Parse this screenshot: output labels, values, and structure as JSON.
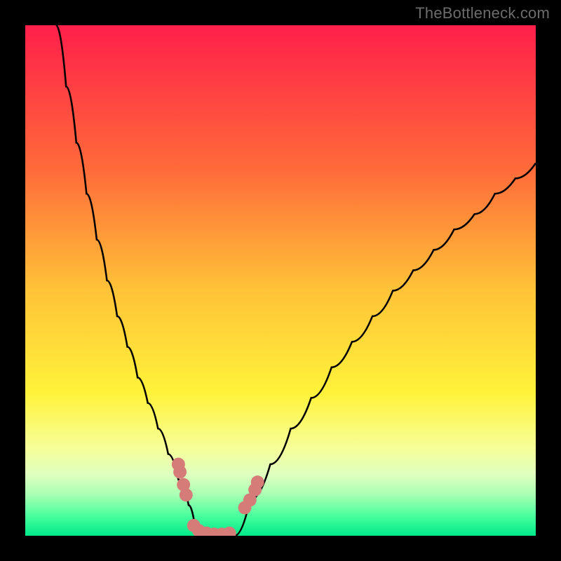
{
  "watermark": "TheBottleneck.com",
  "colors": {
    "frame": "#000000",
    "curve_stroke": "#000000",
    "marker_fill": "#d67c78",
    "gradient_stops": [
      {
        "offset": 0.0,
        "color": "#ff1f4a"
      },
      {
        "offset": 0.28,
        "color": "#ff6a3a"
      },
      {
        "offset": 0.52,
        "color": "#ffc338"
      },
      {
        "offset": 0.72,
        "color": "#fff23a"
      },
      {
        "offset": 0.83,
        "color": "#f6ff9a"
      },
      {
        "offset": 0.88,
        "color": "#dfffc0"
      },
      {
        "offset": 0.92,
        "color": "#a8ffb3"
      },
      {
        "offset": 0.96,
        "color": "#4bff9e"
      },
      {
        "offset": 1.0,
        "color": "#00e98a"
      }
    ]
  },
  "chart_data": {
    "type": "line",
    "title": "",
    "xlabel": "",
    "ylabel": "",
    "xlim": [
      0,
      100
    ],
    "ylim": [
      0,
      100
    ],
    "series": [
      {
        "name": "left-curve",
        "x": [
          6,
          8,
          10,
          12,
          14,
          16,
          18,
          20,
          22,
          24,
          26,
          28,
          30,
          32,
          33.5
        ],
        "y": [
          100,
          88,
          77,
          67,
          58,
          50,
          43,
          37,
          31,
          26,
          21,
          16,
          11,
          6,
          0
        ]
      },
      {
        "name": "right-curve",
        "x": [
          41,
          44,
          48,
          52,
          56,
          60,
          64,
          68,
          72,
          76,
          80,
          84,
          88,
          92,
          96,
          100
        ],
        "y": [
          0,
          7,
          14,
          21,
          27,
          33,
          38,
          43,
          48,
          52,
          56,
          60,
          63,
          67,
          70,
          73
        ]
      },
      {
        "name": "floor",
        "x": [
          33.5,
          41
        ],
        "y": [
          0,
          0
        ]
      }
    ],
    "markers": [
      {
        "name": "left-cluster-1",
        "x": 30.0,
        "y": 14.0
      },
      {
        "name": "left-cluster-2",
        "x": 30.3,
        "y": 12.5
      },
      {
        "name": "left-cluster-3",
        "x": 31.0,
        "y": 10.0
      },
      {
        "name": "left-cluster-4",
        "x": 31.5,
        "y": 8.0
      },
      {
        "name": "floor-1",
        "x": 33.0,
        "y": 2.0
      },
      {
        "name": "floor-2",
        "x": 34.0,
        "y": 1.0
      },
      {
        "name": "floor-3",
        "x": 35.5,
        "y": 0.5
      },
      {
        "name": "floor-4",
        "x": 37.0,
        "y": 0.3
      },
      {
        "name": "floor-5",
        "x": 38.5,
        "y": 0.3
      },
      {
        "name": "floor-6",
        "x": 40.0,
        "y": 0.5
      },
      {
        "name": "right-cluster-1",
        "x": 43.0,
        "y": 5.5
      },
      {
        "name": "right-cluster-2",
        "x": 44.0,
        "y": 7.0
      },
      {
        "name": "right-cluster-3",
        "x": 45.0,
        "y": 9.0
      },
      {
        "name": "right-cluster-4",
        "x": 45.5,
        "y": 10.5
      }
    ]
  }
}
